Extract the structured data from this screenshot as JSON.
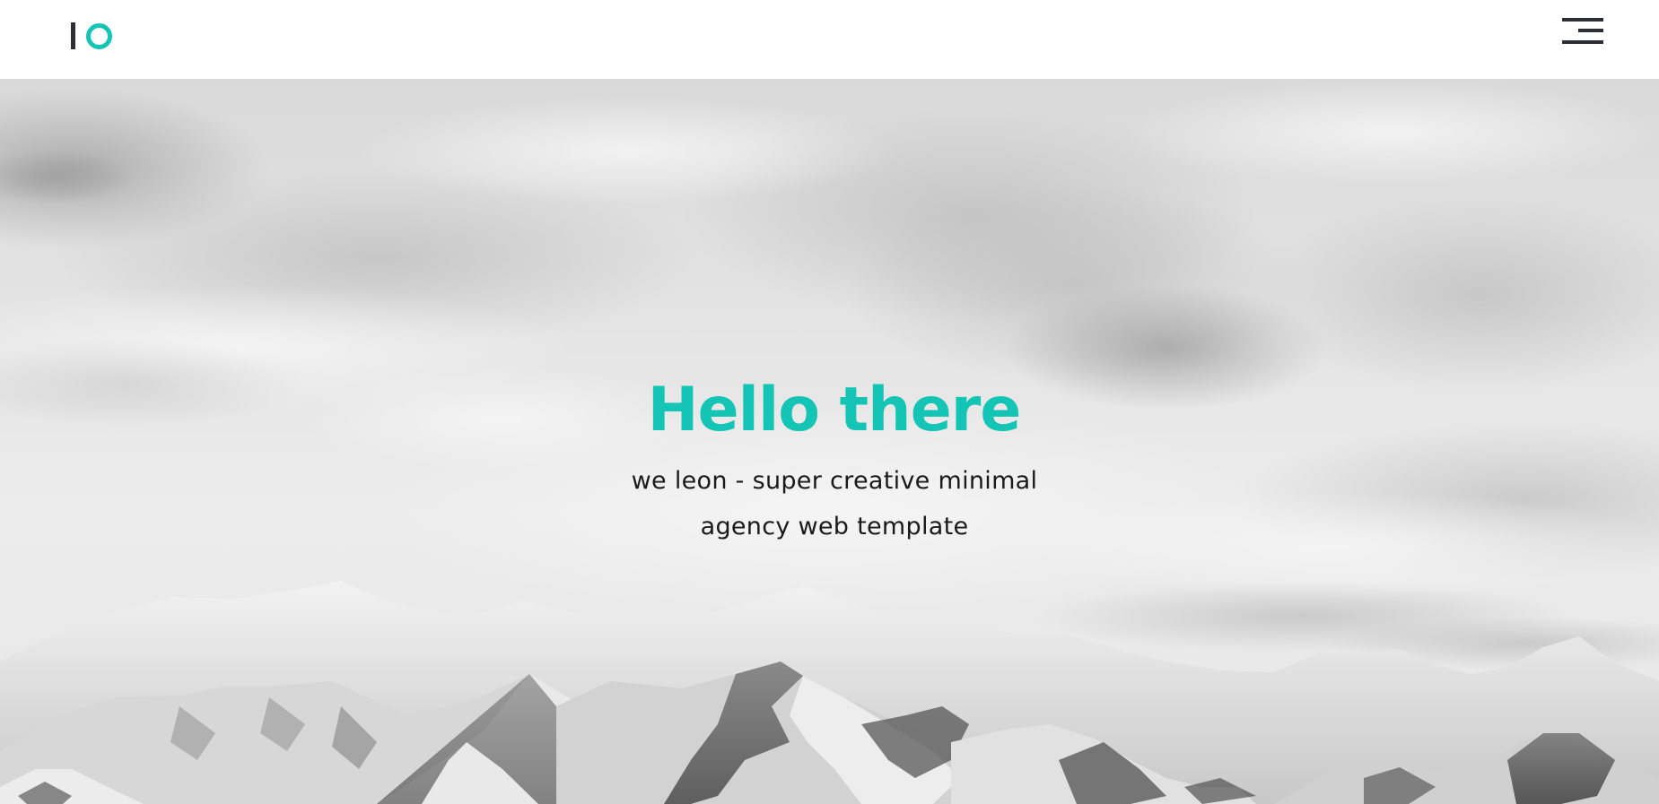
{
  "header": {
    "logo_icon": "io-logo-icon",
    "menu_icon": "hamburger-menu-icon"
  },
  "hero": {
    "title": "Hello there",
    "subtitle_line1": "we leon - super creative minimal",
    "subtitle_line2": "agency web template",
    "background": "black-and-white snowy mountain range under cloudy sky"
  },
  "colors": {
    "accent": "#14c4b4",
    "dark": "#2b2e35",
    "text": "#1a1a1a",
    "header_bg": "#ffffff"
  }
}
